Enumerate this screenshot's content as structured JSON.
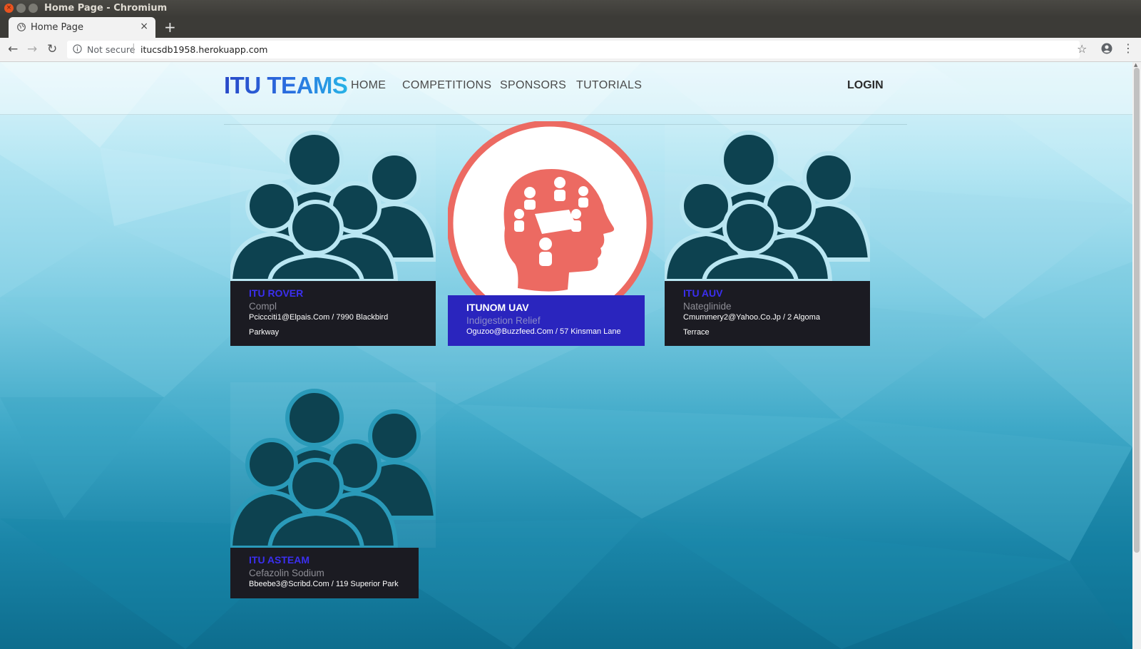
{
  "window": {
    "title": "Home Page - Chromium"
  },
  "tab": {
    "label": "Home Page",
    "close": "×",
    "new_tab": "+"
  },
  "address_bar": {
    "security": "Not secure",
    "url": "itucsdb1958.herokuapp.com"
  },
  "site": {
    "logo": "ITU TEAMS",
    "nav": [
      "HOME",
      "COMPETITIONS",
      "SPONSORS",
      "TUTORIALS"
    ],
    "login": "LOGIN"
  },
  "teams": [
    {
      "name": "ITU ROVER",
      "subtitle": "Compl",
      "info_line1": "Pciccciti1@Elpais.Com / 7990 Blackbird",
      "info_line2": "Parkway",
      "image": "team-silhouette-icon",
      "highlighted": false
    },
    {
      "name": "ITUNOM UAV",
      "subtitle": "Indigestion Relief",
      "info_line1": "Oguzoo@Buzzfeed.Com / 57 Kinsman Lane",
      "info_line2": "",
      "image": "team-head-icon",
      "highlighted": true
    },
    {
      "name": "ITU AUV",
      "subtitle": "Nateglinide",
      "info_line1": "Cmummery2@Yahoo.Co.Jp / 2 Algoma",
      "info_line2": "Terrace",
      "image": "team-silhouette-icon",
      "highlighted": false
    },
    {
      "name": "ITU ASTEAM",
      "subtitle": "Cefazolin Sodium",
      "info_line1": "Bbeebe3@Scribd.Com / 119 Superior Park",
      "info_line2": "",
      "image": "team-silhouette-icon",
      "highlighted": false
    }
  ],
  "colors": {
    "silhouette": "#0d4250",
    "head_icon": "#ec6a62",
    "caption_dark": "#1b1b22",
    "caption_highlight": "#2a25be",
    "team_title": "#3b2ff0"
  }
}
